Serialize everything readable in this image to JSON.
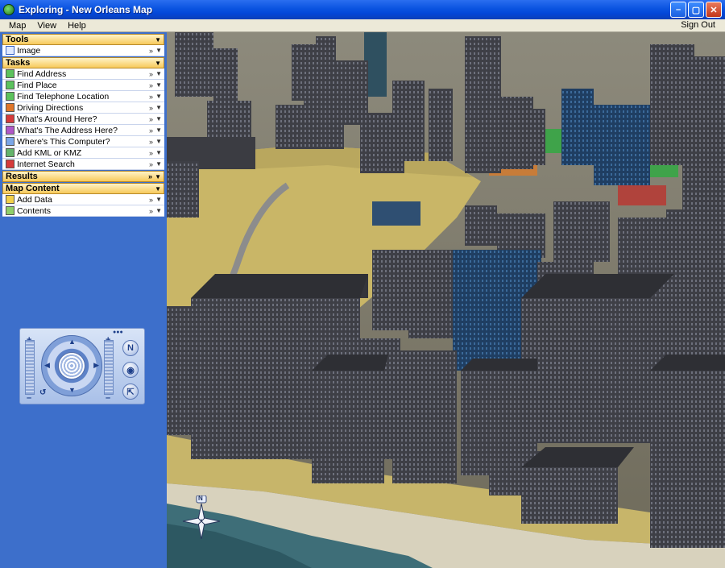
{
  "window": {
    "title": "Exploring - New Orleans Map"
  },
  "menu": {
    "items": [
      "Map",
      "View",
      "Help"
    ],
    "signout": "Sign Out"
  },
  "panel": {
    "tools": {
      "label": "Tools",
      "items": [
        {
          "label": "Image"
        }
      ]
    },
    "tasks": {
      "label": "Tasks",
      "items": [
        {
          "label": "Find Address"
        },
        {
          "label": "Find Place"
        },
        {
          "label": "Find Telephone Location"
        },
        {
          "label": "Driving Directions"
        },
        {
          "label": "What's Around Here?"
        },
        {
          "label": "What's The Address Here?"
        },
        {
          "label": "Where's This Computer?"
        },
        {
          "label": "Add KML or KMZ"
        },
        {
          "label": "Internet Search"
        }
      ]
    },
    "results": {
      "label": "Results"
    },
    "map_content": {
      "label": "Map Content",
      "items": [
        {
          "label": "Add Data"
        },
        {
          "label": "Contents"
        }
      ]
    }
  },
  "compass": {
    "north_label": "N"
  },
  "icons": {
    "expand": "double-chevron-icon",
    "dropdown": "chevron-down-icon"
  },
  "colors": {
    "panel_bg": "#3d6fcb",
    "header_bg": "#f7c95a",
    "titlebar": "#0a53e0"
  }
}
